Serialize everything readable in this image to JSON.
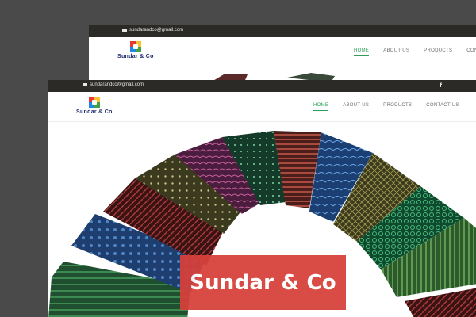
{
  "site": {
    "email": "sundarandco@gmail.com",
    "logo_text": "Sundar & Co",
    "social": "f",
    "nav": [
      {
        "label": "HOME",
        "active": true
      },
      {
        "label": "ABOUT US",
        "active": false
      },
      {
        "label": "PRODUCTS",
        "active": false
      },
      {
        "label": "CONTACT US",
        "active": false
      }
    ],
    "back_nav": [
      {
        "label": "HOME",
        "active": true
      },
      {
        "label": "ABOUT US",
        "active": false
      },
      {
        "label": "PRODUCTS",
        "active": false
      },
      {
        "label": "CONTAC",
        "active": false
      }
    ]
  },
  "hero": {
    "title": "Sundar & Co"
  },
  "colors": {
    "topbar": "#2b2a26",
    "accent_green": "#2e9e59",
    "title_bg": "#d6413a",
    "backdrop": "#4a4a4a"
  },
  "icons": {
    "email": "envelope-icon",
    "social": "facebook-icon"
  }
}
